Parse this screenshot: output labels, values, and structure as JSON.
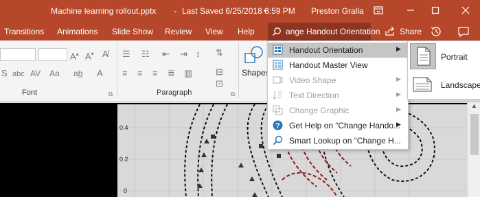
{
  "titlebar": {
    "document_title": "Machine learning rollout.pptx",
    "separator": "-",
    "save_status": "Last Saved 6/25/2018 3:59 PM",
    "dropdown_glyph": "▾",
    "user_name": "Preston Gralla",
    "colors": {
      "title_bg": "#b7472a"
    }
  },
  "tabs": {
    "items": [
      "Transitions",
      "Animations",
      "Slide Show",
      "Review",
      "View",
      "Help"
    ],
    "tell_me_text": "ange Handout Orientation",
    "share_label": "Share"
  },
  "ribbon": {
    "font_group_label": "Font",
    "paragraph_group_label": "Paragraph",
    "shapes_label": "Shapes",
    "font_row2": {
      "s": "S",
      "abc": "abc",
      "aa": "Aa",
      "a": "A"
    }
  },
  "context_menu": {
    "items": [
      {
        "label": "Handout Orientation",
        "has_submenu": true,
        "enabled": true,
        "highlighted": true,
        "icon": "handout-orientation-icon"
      },
      {
        "label": "Handout Master View",
        "has_submenu": false,
        "enabled": true,
        "highlighted": false,
        "icon": "handout-master-view-icon"
      },
      {
        "label": "Video Shape",
        "has_submenu": true,
        "enabled": false,
        "highlighted": false,
        "icon": "video-shape-icon"
      },
      {
        "label": "Text Direction",
        "has_submenu": true,
        "enabled": false,
        "highlighted": false,
        "icon": "text-direction-icon"
      },
      {
        "label": "Change Graphic",
        "has_submenu": true,
        "enabled": false,
        "highlighted": false,
        "icon": "change-graphic-icon"
      },
      {
        "label": "Get Help on “Change Hando...",
        "has_submenu": true,
        "enabled": true,
        "highlighted": false,
        "icon": "help-icon"
      },
      {
        "label": "Smart Lookup on “Change H...",
        "has_submenu": false,
        "enabled": true,
        "highlighted": false,
        "icon": "smart-lookup-icon"
      }
    ]
  },
  "submenu": {
    "items": [
      {
        "label": "Portrait",
        "selected": true
      },
      {
        "label": "Landscape",
        "selected": false
      }
    ]
  },
  "slide": {
    "y_tick_labels": [
      "0.4",
      "0.2",
      "0"
    ]
  }
}
